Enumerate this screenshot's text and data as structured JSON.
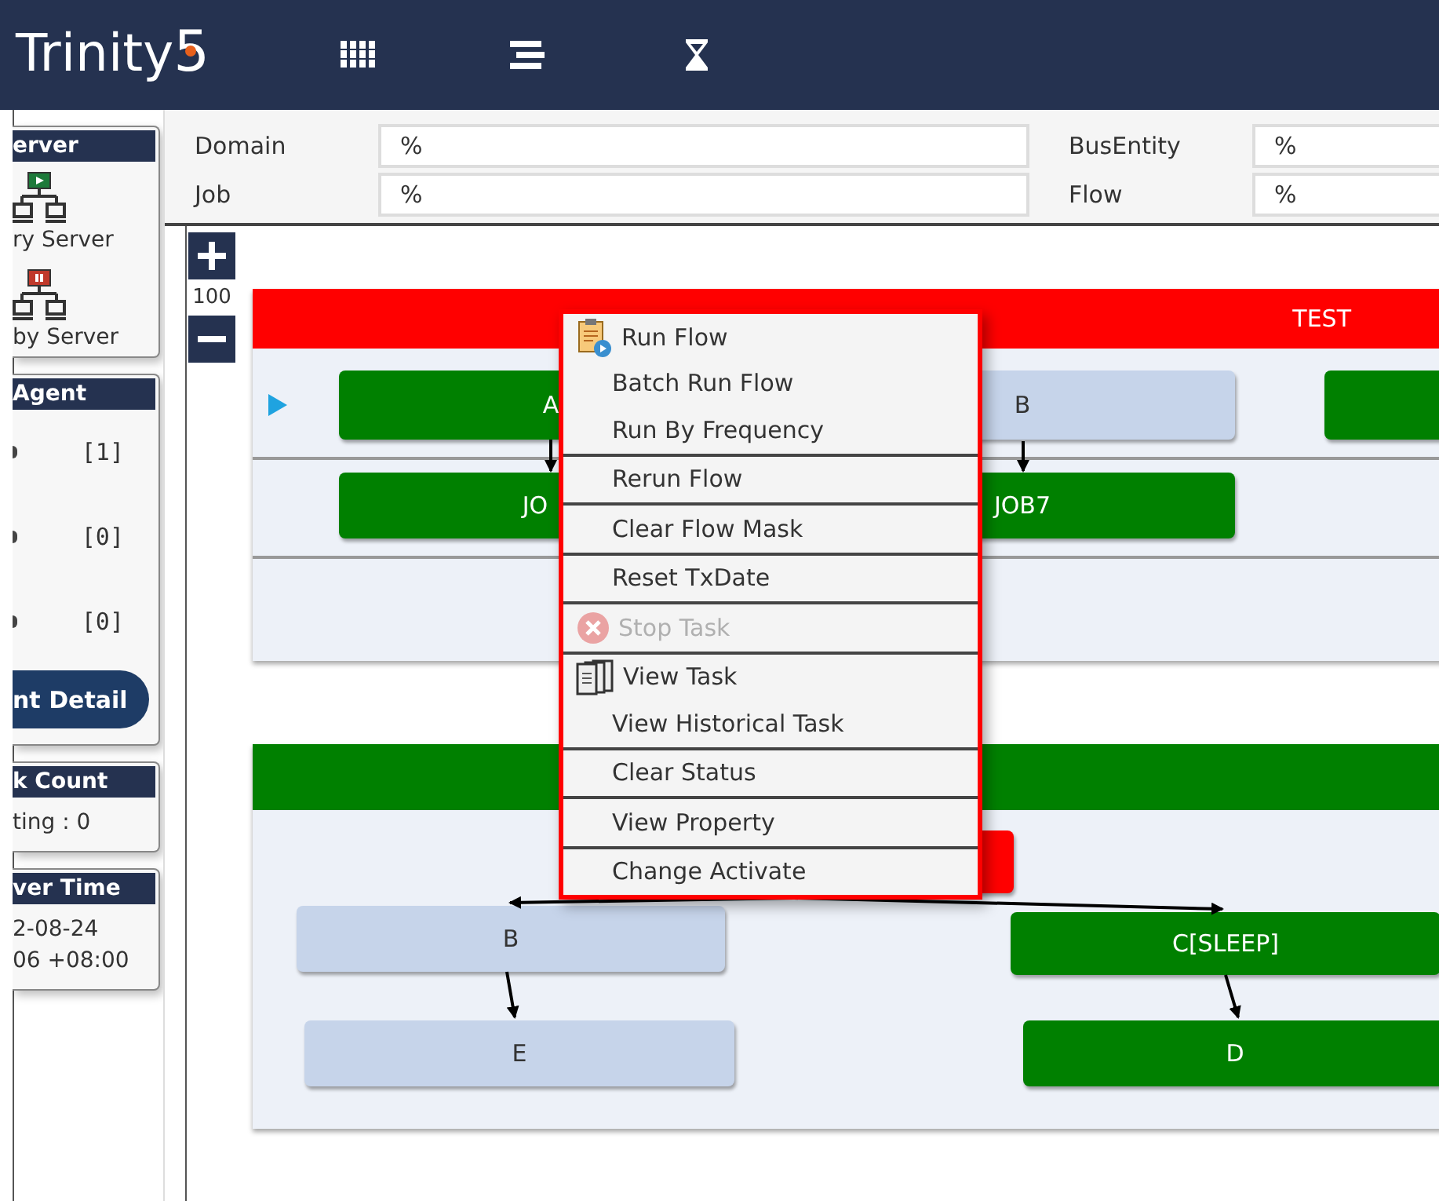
{
  "header": {
    "logo_text": "Trinity",
    "logo_mark": "5"
  },
  "sidebar": {
    "panels": [
      {
        "kind": "servers",
        "title": "erver",
        "servers": [
          {
            "label": "ry Server",
            "color": "#1d7a3a"
          },
          {
            "label": "by Server",
            "color": "#c0392b"
          }
        ]
      },
      {
        "kind": "agents",
        "title": "Agent",
        "rows": [
          "[1]",
          "[0]",
          "[0]"
        ],
        "button": "nt Detail"
      },
      {
        "kind": "text",
        "title": "k Count",
        "lines": [
          "ting : 0"
        ]
      },
      {
        "kind": "text",
        "title": "ver Time",
        "lines": [
          "2-08-24",
          "06 +08:00"
        ]
      }
    ]
  },
  "filters": [
    {
      "label": "Domain",
      "value": "%"
    },
    {
      "label": "BusEntity",
      "value": "%"
    },
    {
      "label": "Job",
      "value": "%"
    },
    {
      "label": "Flow",
      "value": "%"
    }
  ],
  "zoom": {
    "level_text": "100"
  },
  "flows": [
    {
      "title": "TEST",
      "color": "#ff0000",
      "nodes": [
        {
          "label": "A",
          "color": "#008000"
        },
        {
          "label": "B",
          "color": "#c6d4ea"
        },
        {
          "color": "#008000"
        },
        {
          "label": "JO",
          "color": "#008000"
        },
        {
          "label": "JOB7",
          "color": "#008000"
        }
      ]
    },
    {
      "color": "#008000",
      "nodes": [
        {
          "color": "#ff0000"
        },
        {
          "label": "B",
          "color": "#c6d4ea"
        },
        {
          "label": "C[SLEEP]",
          "color": "#008000"
        },
        {
          "label": "E",
          "color": "#c6d4ea"
        },
        {
          "label": "D",
          "color": "#008000"
        }
      ]
    }
  ],
  "context_menu": {
    "groups": [
      [
        {
          "label": "Run Flow",
          "disabled": false
        },
        {
          "label": "Batch Run Flow",
          "disabled": false
        },
        {
          "label": "Run By Frequency",
          "disabled": false
        }
      ],
      [
        {
          "label": "Rerun Flow",
          "disabled": false
        }
      ],
      [
        {
          "label": "Clear Flow Mask",
          "disabled": false
        }
      ],
      [
        {
          "label": "Reset TxDate",
          "disabled": false
        }
      ],
      [
        {
          "label": "Stop Task",
          "disabled": true
        }
      ],
      [
        {
          "label": "View Task",
          "disabled": false
        },
        {
          "label": "View Historical Task",
          "disabled": false
        }
      ],
      [
        {
          "label": "Clear Status",
          "disabled": false
        }
      ],
      [
        {
          "label": "View Property",
          "disabled": false
        }
      ],
      [
        {
          "label": "Change Activate",
          "disabled": false
        }
      ]
    ]
  }
}
